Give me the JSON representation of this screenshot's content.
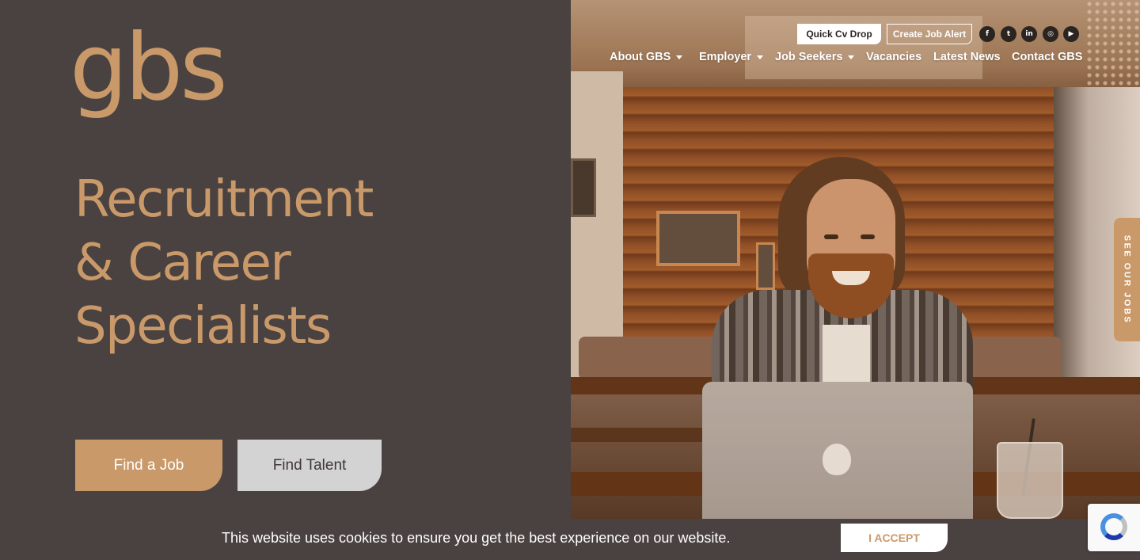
{
  "brand": {
    "logo_text": "gbs"
  },
  "hero": {
    "title_lines": [
      "Recruitment",
      "& Career",
      "Specialists"
    ],
    "find_job_label": "Find a Job",
    "find_talent_label": "Find Talent"
  },
  "header": {
    "quick_cv_label": "Quick Cv Drop",
    "job_alert_label": "Create Job Alert",
    "social": [
      {
        "icon": "facebook-icon",
        "glyph": "f"
      },
      {
        "icon": "twitter-icon",
        "glyph": "t"
      },
      {
        "icon": "linkedin-icon",
        "glyph": "in"
      },
      {
        "icon": "instagram-icon",
        "glyph": "◎"
      },
      {
        "icon": "youtube-icon",
        "glyph": "▶"
      }
    ]
  },
  "nav": {
    "items": [
      {
        "label": "About GBS",
        "has_dropdown": true
      },
      {
        "label": "Employer",
        "has_dropdown": true
      },
      {
        "label": "Job Seekers",
        "has_dropdown": true
      },
      {
        "label": "Vacancies",
        "has_dropdown": false
      },
      {
        "label": "Latest News",
        "has_dropdown": false
      },
      {
        "label": "Contact GBS",
        "has_dropdown": false
      }
    ]
  },
  "side_tab": {
    "label": "SEE OUR JOBS"
  },
  "cookie": {
    "message": "This website uses cookies to ensure you get the best experience on our website.",
    "accept_label": "I ACCEPT"
  },
  "colors": {
    "accent": "#c9996a",
    "background": "#4a4240",
    "button_secondary": "#d4d3d3"
  }
}
